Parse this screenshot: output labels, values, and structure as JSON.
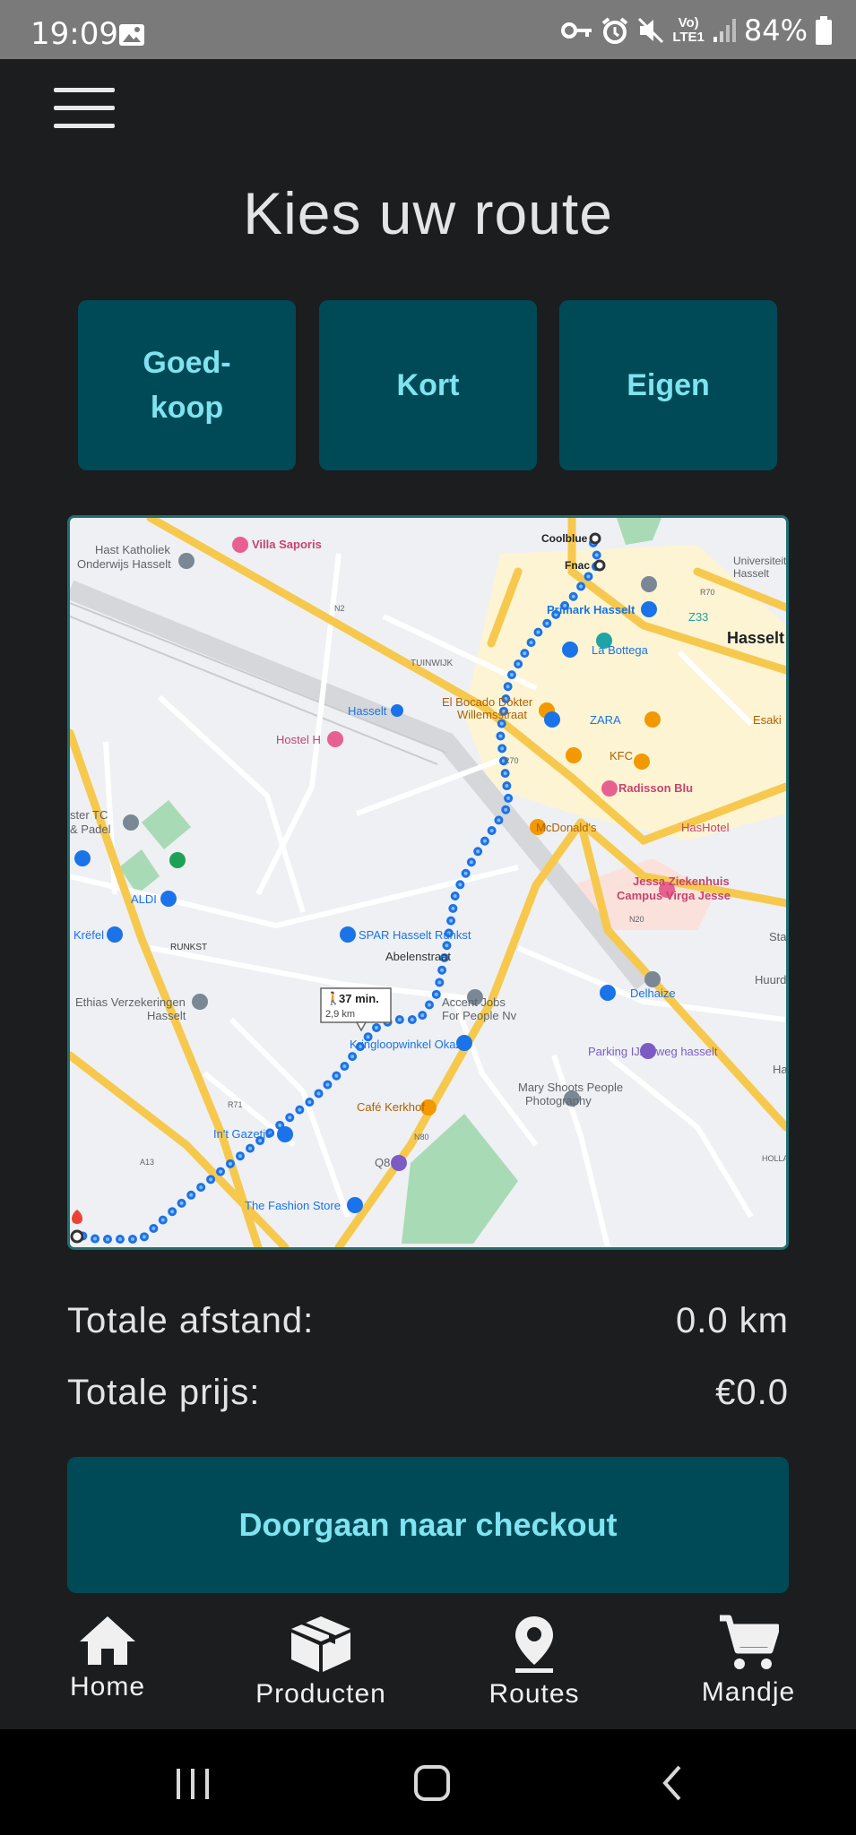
{
  "status_bar": {
    "time": "19:09",
    "battery": "84%",
    "network": "LTE1",
    "volte": "Vo)",
    "icons": [
      "image-icon",
      "key-icon",
      "alarm-icon",
      "mute-icon",
      "signal-icon",
      "battery-icon"
    ]
  },
  "header": {
    "menu_icon": "hamburger-menu-icon",
    "title": "Kies uw route"
  },
  "route_options": {
    "cheap": "Goed-\nkoop",
    "short": "Kort",
    "own": "Eigen"
  },
  "map": {
    "duration": "37 min.",
    "distance": "2,9 km",
    "labels": {
      "hast": "Hast Katholiek",
      "onderwijs": "Onderwijs Hasselt",
      "villa": "Villa Saporis",
      "coolblue": "Coolblue",
      "fnac": "Fnac",
      "universiteit": "Universiteit",
      "hasselt_u": "Hasselt",
      "primark": "Primark Hasselt",
      "z33": "Z33",
      "labottega": "La Bottega",
      "hasselt_city": "Hasselt",
      "tuinwijk": "TUINWIJK",
      "hasselt_station": "Hasselt",
      "bocado": "El Bocado Dokter",
      "willem": "Willemsstraat",
      "zara": "ZARA",
      "esaki": "Esaki",
      "hostel": "Hostel H",
      "kfc": "KFC",
      "radisson": "Radisson Blu",
      "mcdonalds": "McDonald's",
      "hashotel": "HasHotel",
      "sterTC": "ster TC",
      "padel": "& Padel",
      "aldi": "ALDI",
      "jessa1": "Jessa Ziekenhuis",
      "jessa2": "Campus Virga Jesse",
      "krefel": "Krëfel",
      "runkst": "RUNKST",
      "spar": "SPAR Hasselt Runkst",
      "abelen": "Abelenstraat",
      "delhaize": "Delhaize",
      "huurd": "Huurd",
      "ethias1": "Ethias Verzekeringen",
      "ethias2": "Hasselt",
      "accent1": "Accent Jobs",
      "accent2": "For People Nv",
      "kringloop": "Kringloopwinkel Okazi",
      "parking": "Parking IJzerweg hasselt",
      "mary1": "Mary Shoots People",
      "mary2": "Photography",
      "kerkhof": "Café Kerkhof",
      "gazette": "In't Gazetje",
      "q8": "Q8",
      "fashion": "The Fashion Store",
      "r71": "R71",
      "r70a": "R70",
      "r70b": "R70",
      "n20": "N20",
      "n80": "N80",
      "n2": "N2",
      "a13": "A13",
      "holla": "HOLLA",
      "sta": "Sta",
      "ha": "Ha"
    }
  },
  "totals": {
    "distance_label": "Totale afstand:",
    "distance_value": "0.0 km",
    "price_label": "Totale prijs:",
    "price_value": "€0.0"
  },
  "checkout": {
    "label": "Doorgaan naar checkout"
  },
  "bottom_nav": {
    "home": "Home",
    "products": "Producten",
    "routes": "Routes",
    "cart": "Mandje"
  },
  "colors": {
    "background": "#1b1d1f",
    "button": "#004a58",
    "button_text": "#7fe3f0",
    "route_line": "#1a73e8",
    "map_road": "#f6c94e"
  }
}
